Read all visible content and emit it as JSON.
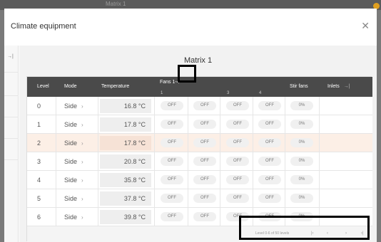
{
  "background": {
    "title": "Matrix 1"
  },
  "dialog": {
    "title": "Climate equipment",
    "close_icon": "✕",
    "collapse_icon": "→|"
  },
  "panel": {
    "title": "Matrix 1"
  },
  "table": {
    "headers": {
      "level": "Level",
      "mode": "Mode",
      "temperature": "Temperature",
      "fans": "Fans 1-4",
      "stir_fans": "Stir fans",
      "inlets": "Inlets",
      "inlets_icon": "→|"
    },
    "fan_columns": [
      "1",
      "",
      "3",
      "4"
    ],
    "rows": [
      {
        "level": "0",
        "mode": "Side",
        "temperature": "16.8 °C",
        "fans": [
          "OFF",
          "OFF",
          "OFF",
          "OFF"
        ],
        "stir": "0%"
      },
      {
        "level": "1",
        "mode": "Side",
        "temperature": "17.8 °C",
        "fans": [
          "OFF",
          "OFF",
          "OFF",
          "OFF"
        ],
        "stir": "0%"
      },
      {
        "level": "2",
        "mode": "Side",
        "temperature": "17.8 °C",
        "fans": [
          "OFF",
          "OFF",
          "OFF",
          "OFF"
        ],
        "stir": "0%"
      },
      {
        "level": "3",
        "mode": "Side",
        "temperature": "20.8 °C",
        "fans": [
          "OFF",
          "OFF",
          "OFF",
          "OFF"
        ],
        "stir": "0%"
      },
      {
        "level": "4",
        "mode": "Side",
        "temperature": "35.8 °C",
        "fans": [
          "OFF",
          "OFF",
          "OFF",
          "OFF"
        ],
        "stir": "0%"
      },
      {
        "level": "5",
        "mode": "Side",
        "temperature": "37.8 °C",
        "fans": [
          "OFF",
          "OFF",
          "OFF",
          "OFF"
        ],
        "stir": "0%"
      },
      {
        "level": "6",
        "mode": "Side",
        "temperature": "39.8 °C",
        "fans": [
          "OFF",
          "OFF",
          "OFF",
          "OFF"
        ],
        "stir": "0%"
      }
    ],
    "mode_arrow": "›",
    "highlighted_row": 2
  },
  "pagination": {
    "summary": "Level 0-6 of 50 levels",
    "first": "|‹",
    "prev": "‹",
    "next": "›",
    "last": "›|"
  },
  "colors": {
    "header_bg": "#4a4a4a",
    "highlight_row": "#fcefe6",
    "marker": "#000000"
  }
}
